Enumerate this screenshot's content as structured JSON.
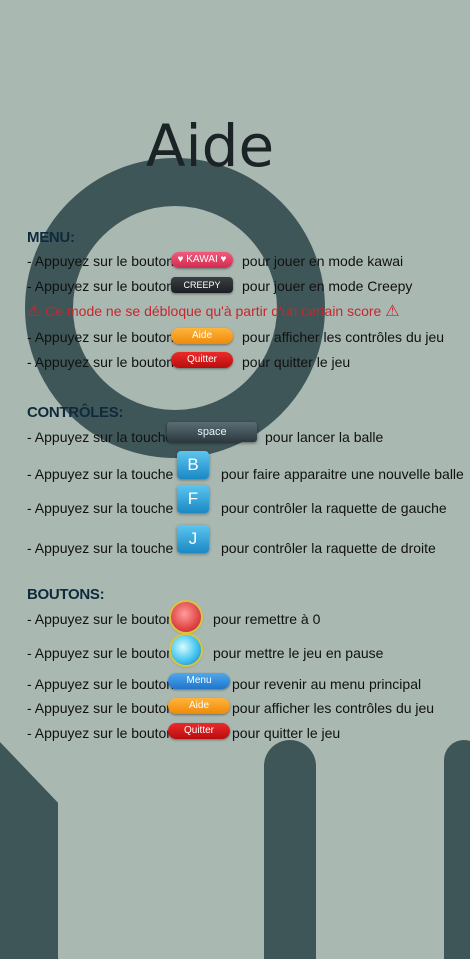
{
  "title": "Aide",
  "menu": {
    "heading": "MENU:",
    "rows": [
      {
        "prefix": "- Appuyez sur le bouton",
        "button": "♥ KAWAI ♥",
        "suffix": "pour jouer en mode kawai"
      },
      {
        "prefix": "- Appuyez sur le bouton",
        "button": "CREEPY",
        "suffix": "pour jouer en mode Creepy"
      },
      {
        "prefix": "- Appuyez sur le bouton",
        "button": "Aide",
        "suffix": "pour afficher les contrôles du jeu"
      },
      {
        "prefix": "- Appuyez sur le bouton",
        "button": "Quitter",
        "suffix": "pour quitter le jeu"
      }
    ],
    "warning": "Ce mode ne se débloque qu'à partir d'un certain score"
  },
  "controls": {
    "heading": "CONTRÔLES:",
    "rows": [
      {
        "prefix": "- Appuyez sur la touche",
        "key": "space",
        "suffix": "pour lancer la balle"
      },
      {
        "prefix": "- Appuyez sur la touche",
        "key": "B",
        "suffix": "pour faire apparaitre une nouvelle balle"
      },
      {
        "prefix": "- Appuyez sur la touche",
        "key": "F",
        "suffix": "pour contrôler la raquette de gauche"
      },
      {
        "prefix": "- Appuyez sur la touche",
        "key": "J",
        "suffix": "pour contrôler la raquette de droite"
      }
    ]
  },
  "buttons": {
    "heading": "BOUTONS:",
    "rows": [
      {
        "prefix": "- Appuyez sur le bouton",
        "suffix": "pour remettre à 0"
      },
      {
        "prefix": "- Appuyez sur le bouton",
        "suffix": "pour mettre le jeu en pause"
      },
      {
        "prefix": "- Appuyez sur le bouton",
        "button": "Menu",
        "suffix": "pour revenir au menu principal"
      },
      {
        "prefix": "- Appuyez sur le bouton",
        "button": "Aide",
        "suffix": "pour afficher les contrôles du jeu"
      },
      {
        "prefix": "- Appuyez sur le bouton",
        "button": "Quitter",
        "suffix": "pour quitter le jeu"
      }
    ]
  },
  "colors": {
    "background": "#a9b8b1",
    "decor": "#3f5658",
    "warning": "#c8262c"
  }
}
